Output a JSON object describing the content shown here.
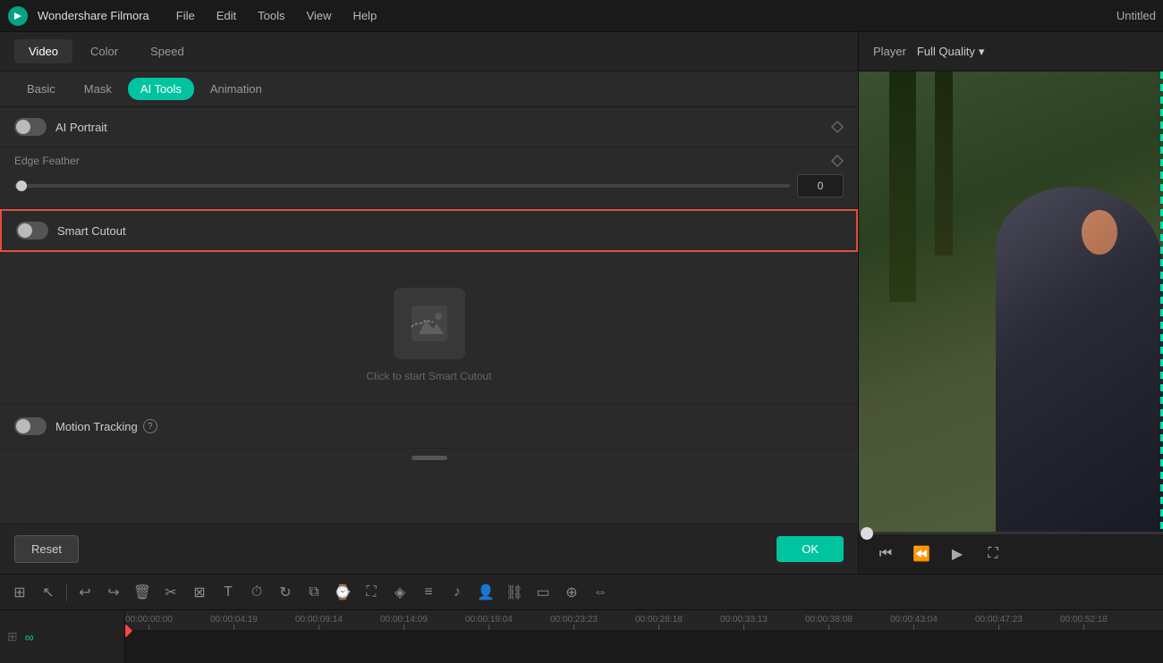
{
  "app": {
    "name": "Wondershare Filmora",
    "title": "Untitled"
  },
  "menubar": {
    "items": [
      "File",
      "Edit",
      "Tools",
      "View",
      "Help"
    ]
  },
  "top_tabs": {
    "items": [
      "Video",
      "Color",
      "Speed"
    ],
    "active": "Video"
  },
  "sub_tabs": {
    "items": [
      "Basic",
      "Mask",
      "AI Tools",
      "Animation"
    ],
    "active": "AI Tools"
  },
  "sections": {
    "ai_portrait": {
      "label": "AI Portrait",
      "enabled": false
    },
    "edge_feather": {
      "label": "Edge Feather",
      "value": "0",
      "slider_pct": 2
    },
    "smart_cutout": {
      "label": "Smart Cutout",
      "enabled": false,
      "placeholder_text": "Click to start Smart Cutout"
    },
    "motion_tracking": {
      "label": "Motion Tracking",
      "enabled": false,
      "help": "?"
    }
  },
  "footer": {
    "reset_label": "Reset",
    "ok_label": "OK"
  },
  "player": {
    "label": "Player",
    "quality_label": "Full Quality"
  },
  "timeline": {
    "markers": [
      "00:00:00:00",
      "00:00:04:19",
      "00:00:09:14",
      "00:00:14:09",
      "00:00:19:04",
      "00:00:23:23",
      "00:00:28:18",
      "00:00:33:13",
      "00:00:38:08",
      "00:00:43:04",
      "00:00:47:23",
      "00:00:52:18"
    ],
    "toolbar_icons": [
      "grid",
      "cursor",
      "undo",
      "redo",
      "delete",
      "cut",
      "crop",
      "text",
      "timer",
      "rotate",
      "layer",
      "clock",
      "fullscreen",
      "paint",
      "sliders",
      "audio",
      "people",
      "link",
      "box",
      "targets",
      "arrows"
    ]
  }
}
